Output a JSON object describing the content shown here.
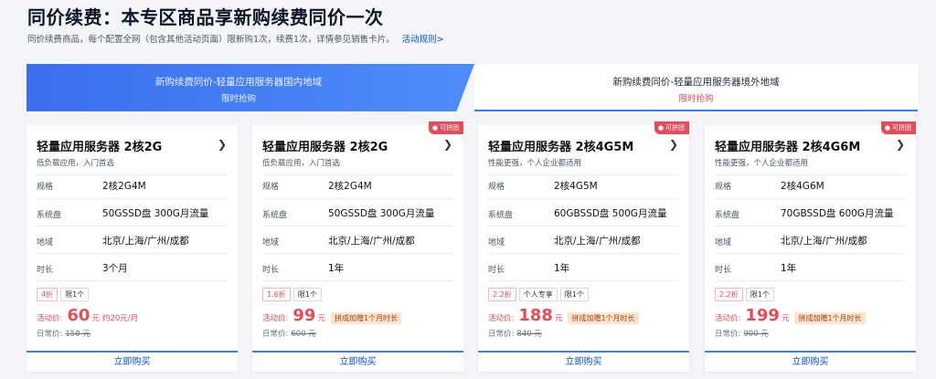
{
  "page": {
    "title": "同价续费：本专区商品享新购续费同价一次",
    "subtitle": "同价续费商品，每个配置全网（包含其他活动页面）限新购1次，续费1次，详情参见销售卡片。",
    "rules_link": "活动规则>"
  },
  "tabs": [
    {
      "title": "新购续费同价-轻量应用服务器国内地域",
      "sub": "限时抢购"
    },
    {
      "title": "新购续费同价-轻量应用服务器境外地域",
      "sub": "限时抢购"
    }
  ],
  "labels": {
    "spec": "规格",
    "disk": "系统盘",
    "region": "地域",
    "duration": "时长",
    "promo": "活动价:",
    "orig": "日常价:",
    "unit": "元",
    "buy": "立即购买"
  },
  "cards": [
    {
      "name": "轻量应用服务器 2核2G",
      "desc": "低负载应用，入门首选",
      "spec": "2核2G4M",
      "disk": "50GSSD盘 300G月流量",
      "region": "北京/上海/广州/成都",
      "duration": "3个月",
      "tags": [
        "4折",
        "限1个"
      ],
      "price": "60",
      "per": "约20元/月",
      "bonus": "",
      "orig_price": "150 元",
      "badge": ""
    },
    {
      "name": "轻量应用服务器 2核2G",
      "desc": "低负载应用，入门首选",
      "spec": "2核2G4M",
      "disk": "50GSSD盘 300G月流量",
      "region": "北京/上海/广州/成都",
      "duration": "1年",
      "tags": [
        "1.6折",
        "限1个"
      ],
      "price": "99",
      "per": "",
      "bonus": "拼成加赠1个月时长",
      "orig_price": "600 元",
      "badge": "可拼团"
    },
    {
      "name": "轻量应用服务器 2核4G5M",
      "desc": "性能更强，个人企业都适用",
      "spec": "2核4G5M",
      "disk": "60GBSSD盘 500G月流量",
      "region": "北京/上海/广州/成都",
      "duration": "1年",
      "tags": [
        "2.2折",
        "个人专享",
        "限1个"
      ],
      "price": "188",
      "per": "",
      "bonus": "拼成加赠1个月时长",
      "orig_price": "840 元",
      "badge": "可拼团"
    },
    {
      "name": "轻量应用服务器 2核4G6M",
      "desc": "性能更强，个人企业都适用",
      "spec": "2核4G6M",
      "disk": "70GBSSD盘 600G月流量",
      "region": "北京/上海/广州/成都",
      "duration": "1年",
      "tags": [
        "2.2折",
        "限1个"
      ],
      "price": "199",
      "per": "",
      "bonus": "拼成加赠1个月时长",
      "orig_price": "900 元",
      "badge": "可拼团"
    }
  ],
  "colors": {
    "accent": "#3d7cf5",
    "price": "#e34d59",
    "link": "#0052d9"
  },
  "icons": {
    "card_arrow": "chevron-right-icon",
    "badge": "group-icon"
  }
}
